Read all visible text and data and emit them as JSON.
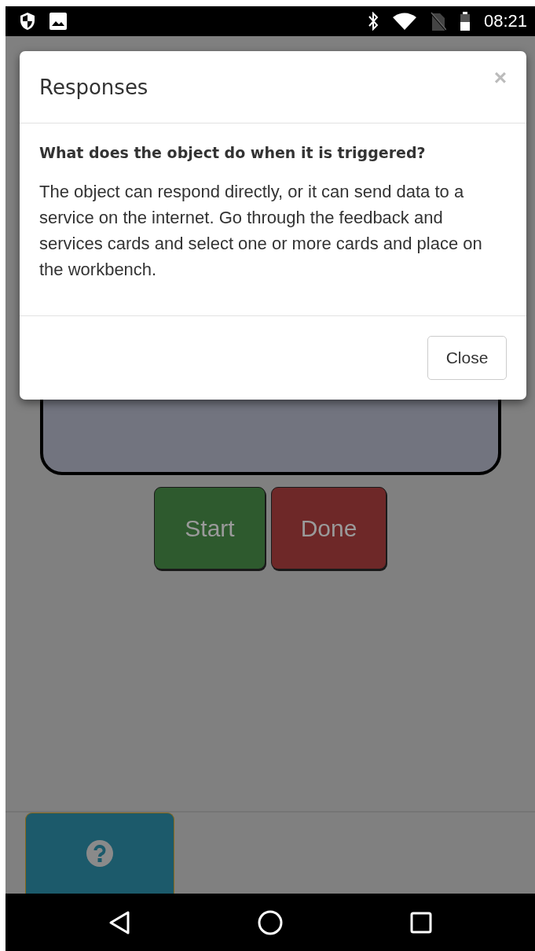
{
  "status_bar": {
    "time": "08:21"
  },
  "buttons": [
    {
      "label": "Start",
      "kind": "start"
    },
    {
      "label": "Done",
      "kind": "done"
    }
  ],
  "dialog": {
    "title": "Responses",
    "close_symbol": "×",
    "question": "What does the object do when it is triggered?",
    "body": "The object can respond directly, or it can send data to a service on the internet. Go through the feedback and services cards and select one or more cards and place on the workbench.",
    "close_button": "Close"
  }
}
